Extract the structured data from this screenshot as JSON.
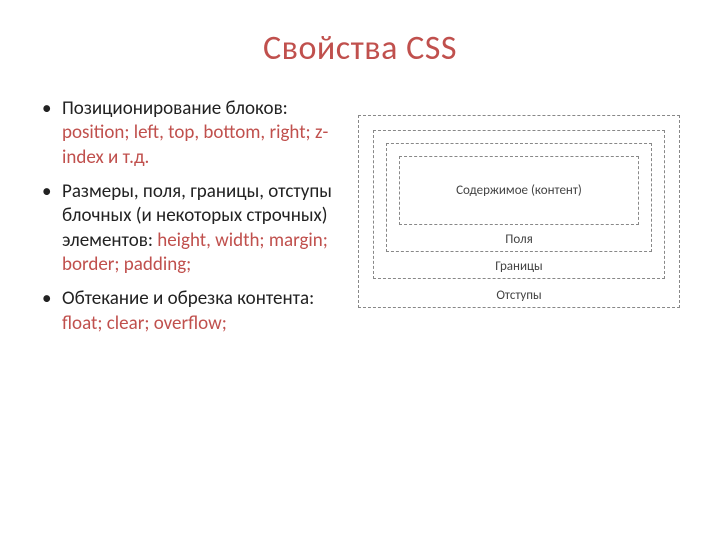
{
  "title": "Свойства CSS",
  "bullets": [
    {
      "plain": "Позиционирование блоков: ",
      "hl": "position; left, top, bottom, right; z-index и т.д."
    },
    {
      "plain": "Размеры, поля, границы, отступы блочных  (и некоторых строчных) элементов: ",
      "hl": "height, width; margin; border; padding;"
    },
    {
      "plain": "Обтекание и обрезка контента: ",
      "hl": "float; clear; overflow;"
    }
  ],
  "boxmodel": {
    "margin": "Отступы",
    "border": "Границы",
    "padding": "Поля",
    "content": "Содержимое (контент)"
  }
}
